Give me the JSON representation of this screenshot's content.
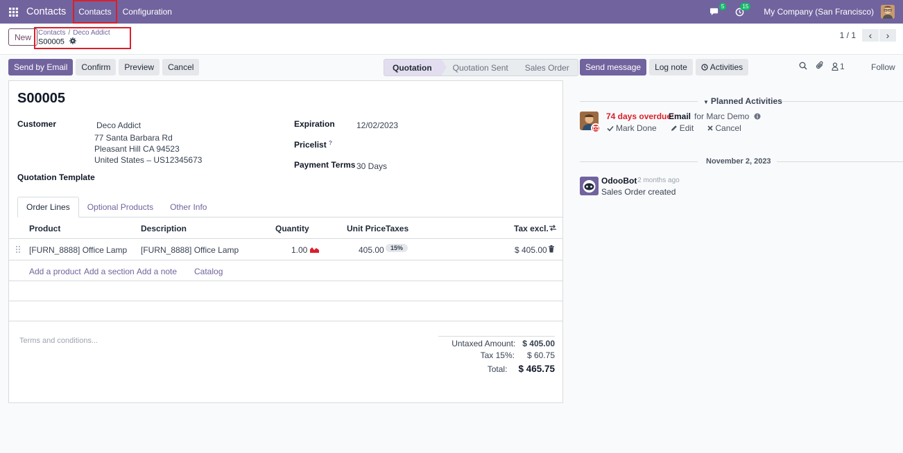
{
  "topbar": {
    "app_name": "Contacts",
    "menu": [
      "Contacts",
      "Configuration"
    ],
    "messages_count": "5",
    "activities_count": "15",
    "company": "My Company (San Francisco)"
  },
  "control_panel": {
    "new_label": "New",
    "breadcrumb": [
      "Contacts",
      "Deco Addict"
    ],
    "breadcrumb_separator": "/",
    "current_record": "S00005",
    "pager": "1 / 1"
  },
  "action_buttons": [
    "Send by Email",
    "Confirm",
    "Preview",
    "Cancel"
  ],
  "status_stages": [
    "Quotation",
    "Quotation Sent",
    "Sales Order"
  ],
  "form": {
    "name": "S00005",
    "customer_label": "Customer",
    "customer_name": "Deco Addict",
    "customer_address": [
      "77 Santa Barbara Rd",
      "Pleasant Hill CA 94523",
      "United States – US12345673"
    ],
    "quotation_template_label": "Quotation Template",
    "expiration_label": "Expiration",
    "expiration_value": "12/02/2023",
    "pricelist_label": "Pricelist",
    "pricelist_help": "?",
    "payment_terms_label": "Payment Terms",
    "payment_terms_value": "30 Days"
  },
  "tabs": [
    "Order Lines",
    "Optional Products",
    "Other Info"
  ],
  "order_lines": {
    "columns": [
      "Product",
      "Description",
      "Quantity",
      "Unit Price",
      "Taxes",
      "Tax excl."
    ],
    "rows": [
      {
        "product": "[FURN_8888] Office Lamp",
        "description": "[FURN_8888] Office Lamp",
        "quantity": "1.00",
        "unit_price": "405.00",
        "taxes": "15%",
        "subtotal": "$ 405.00"
      }
    ],
    "add_links": [
      "Add a product",
      "Add a section",
      "Add a note",
      "Catalog"
    ]
  },
  "terms_placeholder": "Terms and conditions...",
  "totals": {
    "untaxed_label": "Untaxed Amount:",
    "untaxed_value": "$ 405.00",
    "tax_label": "Tax 15%:",
    "tax_value": "$ 60.75",
    "total_label": "Total:",
    "total_value": "$ 465.75"
  },
  "chatter": {
    "buttons": [
      "Send message",
      "Log note",
      "Activities"
    ],
    "followers_count": "1",
    "follow_label": "Follow",
    "planned_label": "Planned Activities",
    "activity": {
      "overdue": "74 days overdue:",
      "type": "Email",
      "for_text": "for Marc Demo",
      "actions": [
        "Mark Done",
        "Edit",
        "Cancel"
      ]
    },
    "date_separator": "November 2, 2023",
    "message": {
      "author": "OdooBot",
      "time": "- 2 months ago",
      "body": "Sales Order created"
    }
  },
  "colors": {
    "brand": "#71639e",
    "highlight": "#d9202b",
    "overdue": "#d9202b"
  }
}
